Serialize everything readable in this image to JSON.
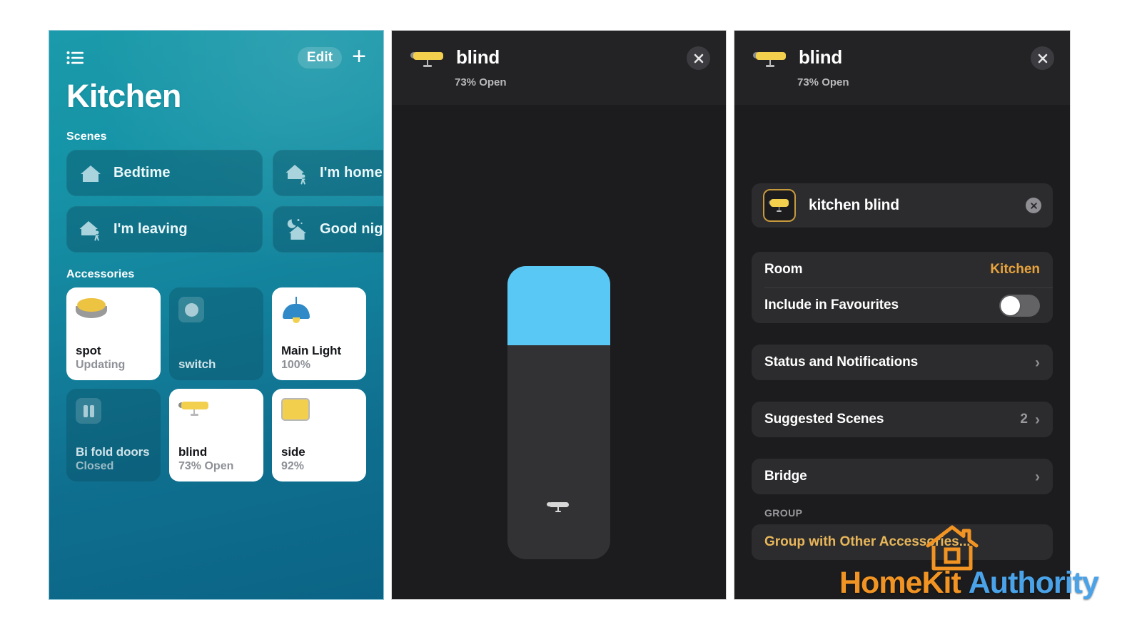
{
  "home": {
    "topbar": {
      "list_icon": "list-icon",
      "edit_label": "Edit",
      "add_label": "+"
    },
    "room_title": "Kitchen",
    "scenes_heading": "Scenes",
    "scenes": [
      {
        "label": "Bedtime",
        "icon": "house-icon"
      },
      {
        "label": "I'm home",
        "icon": "house-walking-icon"
      },
      {
        "label": "I'm leaving",
        "icon": "house-walking-icon"
      },
      {
        "label": "Good night",
        "icon": "moon-house-icon"
      }
    ],
    "accessories_heading": "Accessories",
    "accessories": [
      {
        "name": "spot",
        "state": "Updating",
        "on": true,
        "icon": "spot-light-icon"
      },
      {
        "name": "switch",
        "state": "",
        "on": false,
        "icon": "switch-button-icon"
      },
      {
        "name": "Main Light",
        "state": "100%",
        "on": true,
        "icon": "pendant-light-icon"
      },
      {
        "name": "Bi fold doors",
        "state": "Closed",
        "on": false,
        "icon": "bifold-doors-icon"
      },
      {
        "name": "blind",
        "state": "73% Open",
        "on": true,
        "icon": "blind-icon"
      },
      {
        "name": "side",
        "state": "92%",
        "on": true,
        "icon": "window-blind-icon"
      }
    ]
  },
  "control": {
    "title": "blind",
    "subtitle": "73% Open",
    "close_label": "Close",
    "slider": {
      "open_percent": 73,
      "fill_percent": 27,
      "fill_color": "#5ac8f5",
      "track_color": "#323234"
    }
  },
  "settings": {
    "title": "blind",
    "subtitle": "73% Open",
    "close_label": "Close",
    "accessory": {
      "name": "kitchen blind",
      "remove_label": "Remove"
    },
    "rows": [
      {
        "label": "Room",
        "value": "Kitchen",
        "type": "value"
      },
      {
        "label": "Include in Favourites",
        "value": "off",
        "type": "toggle"
      }
    ],
    "links": [
      {
        "label": "Status and Notifications",
        "count": "",
        "type": "chevron"
      },
      {
        "label": "Suggested Scenes",
        "count": "2",
        "type": "chevron"
      },
      {
        "label": "Bridge",
        "count": "",
        "type": "chevron"
      }
    ],
    "group_heading": "GROUP",
    "group_action": "Group with Other Accessories...",
    "accent_color": "#e8a33d"
  },
  "watermark": {
    "part1": "HomeKit",
    "part2": "Authority",
    "icon": "house-outline-icon"
  }
}
